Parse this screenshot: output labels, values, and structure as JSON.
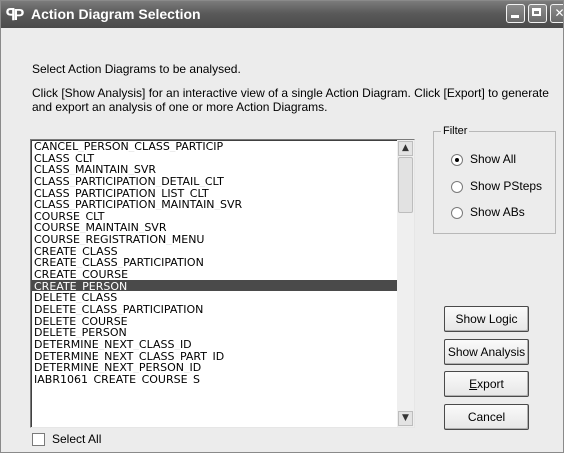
{
  "window": {
    "app_icon": "ꟼP",
    "title": "Action Diagram Selection"
  },
  "instructions": {
    "line1": "Select Action Diagrams to be analysed.",
    "line2a": "Click [Show Analysis] for an interactive view of a single Action Diagram. Click [Export] to generate",
    "line2b": "and export an analysis of one or more Action Diagrams."
  },
  "list": {
    "items": [
      "CANCEL_PERSON_CLASS_PARTICIP",
      "CLASS_CLT",
      "CLASS_MAINTAIN_SVR",
      "CLASS_PARTICIPATION_DETAIL_CLT",
      "CLASS_PARTICIPATION_LIST_CLT",
      "CLASS_PARTICIPATION_MAINTAIN_SVR",
      "COURSE_CLT",
      "COURSE_MAINTAIN_SVR",
      "COURSE_REGISTRATION_MENU",
      "CREATE_CLASS",
      "CREATE_CLASS_PARTICIPATION",
      "CREATE_COURSE",
      "CREATE_PERSON",
      "DELETE_CLASS",
      "DELETE_CLASS_PARTICIPATION",
      "DELETE_COURSE",
      "DELETE_PERSON",
      "DETERMINE_NEXT_CLASS_ID",
      "DETERMINE_NEXT_CLASS_PART_ID",
      "DETERMINE_NEXT_PERSON_ID",
      "IABR1061_CREATE_COURSE_S"
    ],
    "selected_index": 12,
    "scroll_up_icon": "▲",
    "scroll_down_icon": "▼"
  },
  "filter": {
    "legend": "Filter",
    "options": [
      "Show All",
      "Show PSteps",
      "Show ABs"
    ],
    "selected": "Show All"
  },
  "buttons": {
    "show_logic": "Show Logic",
    "show_analysis": "Show Analysis",
    "export": "Export",
    "cancel": "Cancel"
  },
  "select_all": {
    "label": "Select All",
    "checked": false
  }
}
